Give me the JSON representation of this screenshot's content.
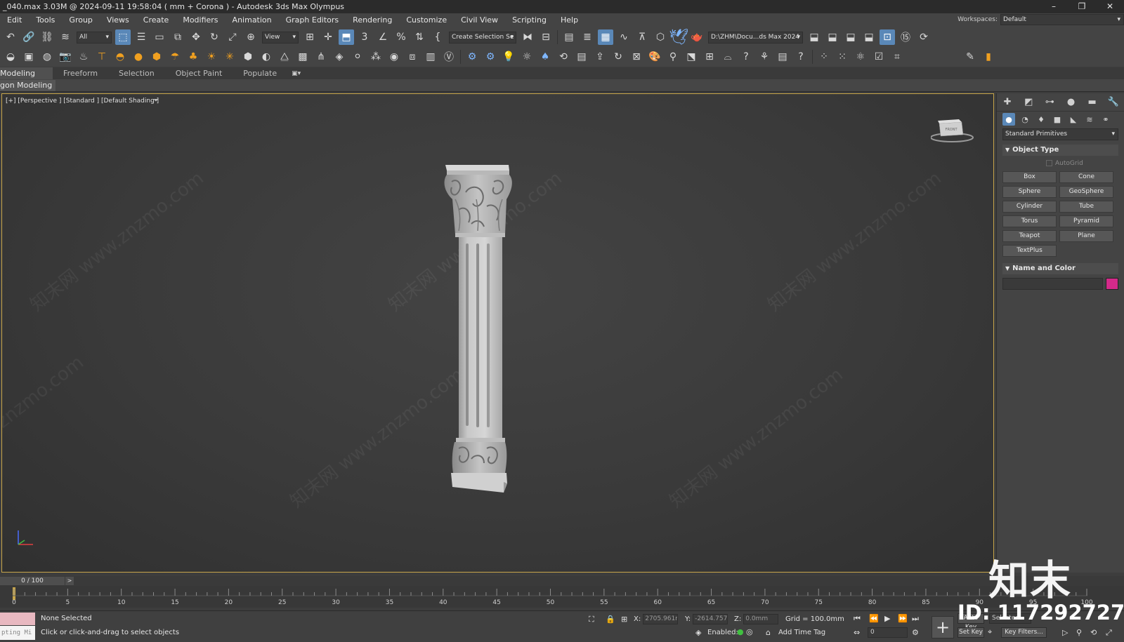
{
  "window": {
    "title": "_040.max  3.03M @ 2024-09-11 19:58:04  ( mm + Corona ) - Autodesk 3ds Max Olympus",
    "minimize": "–",
    "maximize": "❐",
    "close": "✕"
  },
  "menubar": {
    "items": [
      "Edit",
      "Tools",
      "Group",
      "Views",
      "Create",
      "Modifiers",
      "Animation",
      "Graph Editors",
      "Rendering",
      "Customize",
      "Civil View",
      "Scripting",
      "Help"
    ],
    "workspaces_label": "Workspaces:",
    "workspaces_value": "Default"
  },
  "toolbar1": {
    "filter_value": "All",
    "refcoord_value": "View",
    "selection_set_placeholder": "Create Selection Se",
    "project_path": "D:\\ZHM\\Docu...ds Max 2024"
  },
  "ribbon": {
    "tabs": [
      "Modeling",
      "Freeform",
      "Selection",
      "Object Paint",
      "Populate"
    ],
    "panel_label": "gon Modeling"
  },
  "viewport": {
    "label": "[+] [Perspective ] [Standard ] [Default Shading ]",
    "viewcube_face": "FRONT",
    "watermark_text": "知末网 www.znzmo.com",
    "watermark_text2": "znzmo.com"
  },
  "command_panel": {
    "primitive_type": "Standard Primitives",
    "object_type_header": "Object Type",
    "autogrid_label": "AutoGrid",
    "buttons": [
      "Box",
      "Cone",
      "Sphere",
      "GeoSphere",
      "Cylinder",
      "Tube",
      "Torus",
      "Pyramid",
      "Teapot",
      "Plane",
      "TextPlus"
    ],
    "name_color_header": "Name and Color",
    "color": "#d42a8a"
  },
  "timeline": {
    "frame_display": "0 / 100",
    "next_arrow": ">",
    "ticks": [
      "0",
      "5",
      "10",
      "15",
      "20",
      "25",
      "30",
      "35",
      "40",
      "45",
      "50",
      "55",
      "60",
      "65",
      "70",
      "75",
      "80",
      "85",
      "90",
      "95",
      "100"
    ]
  },
  "status": {
    "script_listener_text": "pting Mi",
    "selection_status": "None Selected",
    "prompt": "Click or click-and-drag to select objects",
    "x_label": "X:",
    "x_value": "2705.961m",
    "y_label": "Y:",
    "y_value": "-2614.757r",
    "z_label": "Z:",
    "z_value": "0.0mm",
    "grid": "Grid = 100.0mm",
    "enabled_label": "Enabled:",
    "add_time_tag": "Add Time Tag",
    "frame_field": "0",
    "auto_key": "Auto Key",
    "selected_dd": "Selected",
    "set_key": "Set Key",
    "key_filters": "Key Filters..."
  },
  "branding": {
    "logo_text": "知末",
    "id_text": "ID: 1172927274"
  }
}
